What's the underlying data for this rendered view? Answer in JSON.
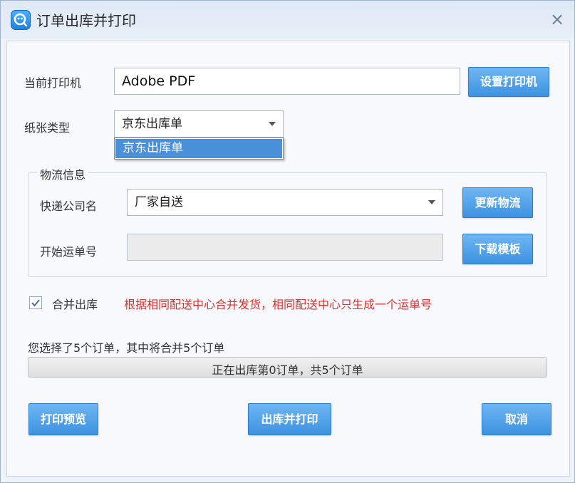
{
  "window": {
    "title": "订单出库并打印",
    "close_glyph": "×"
  },
  "printer": {
    "label": "当前打印机",
    "value": "Adobe PDF",
    "button": "设置打印机"
  },
  "paper": {
    "label": "纸张类型",
    "selected": "京东出库单",
    "options": [
      "京东出库单"
    ]
  },
  "logistics": {
    "group_title": "物流信息",
    "company_label": "快递公司名",
    "company_value": "厂家自送",
    "update_button": "更新物流",
    "waybill_label": "开始运单号",
    "waybill_value": "",
    "download_button": "下载模板"
  },
  "merge": {
    "label": "合并出库",
    "checked": true,
    "note": "根据相同配送中心合并发货，相同配送中心只生成一个运单号"
  },
  "summary": "您选择了5个订单，其中将合并5个订单",
  "progress": {
    "text": "正在出库第0订单，共5个订单",
    "value": 0
  },
  "buttons": {
    "preview": "打印预览",
    "print": "出库并打印",
    "cancel": "取消"
  },
  "colors": {
    "accent": "#3d92e0",
    "warning_text": "#e0302c",
    "selection": "#4a90d9"
  }
}
